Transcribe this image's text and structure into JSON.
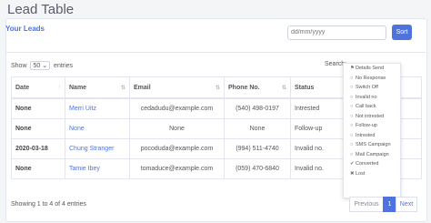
{
  "page_title": "Lead Table",
  "card_header": "Your Leads",
  "date_input": {
    "placeholder": "dd/mm/yyyy"
  },
  "sort_label": "Sort",
  "show": {
    "prefix": "Show",
    "value": "50",
    "suffix": "entries"
  },
  "search_label": "Search:",
  "columns": [
    "Date",
    "Name",
    "Email",
    "Phone No.",
    "Status"
  ],
  "rows": [
    {
      "date": "None",
      "name": "Merri Uitz",
      "email": "cedadudu@example.com",
      "phone": "(540) 498-0197",
      "status": "Intrested"
    },
    {
      "date": "None",
      "name": "None",
      "email": "None",
      "phone": "None",
      "status": "Follow-up"
    },
    {
      "date": "2020-03-18",
      "name": "Chung Stranger",
      "email": "pocoduda@example.com",
      "phone": "(994) 511-4740",
      "status": "Invalid no."
    },
    {
      "date": "None",
      "name": "Tamie Ibey",
      "email": "tomaduce@example.com",
      "phone": "(059) 470-6840",
      "status": "Invalid no."
    }
  ],
  "status_menu": [
    {
      "icon": "flag-icon",
      "glyph": "⚑",
      "label": "Details Send"
    },
    {
      "icon": "circle-icon",
      "glyph": "○",
      "label": "No Response"
    },
    {
      "icon": "circle-icon",
      "glyph": "○",
      "label": "Switch Off"
    },
    {
      "icon": "circle-icon",
      "glyph": "○",
      "label": "Invalid no"
    },
    {
      "icon": "circle-icon",
      "glyph": "○",
      "label": "Call back"
    },
    {
      "icon": "circle-icon",
      "glyph": "○",
      "label": "Not intrested"
    },
    {
      "icon": "circle-icon",
      "glyph": "○",
      "label": "Follow-up"
    },
    {
      "icon": "circle-icon",
      "glyph": "○",
      "label": "Intrested"
    },
    {
      "icon": "circle-icon",
      "glyph": "○",
      "label": "SMS Campaign"
    },
    {
      "icon": "circle-icon",
      "glyph": "○",
      "label": "Mail Campaign"
    },
    {
      "icon": "check-icon",
      "glyph": "✔",
      "label": "Converted"
    },
    {
      "icon": "cross-icon",
      "glyph": "✖",
      "label": "Lost"
    }
  ],
  "footer_text": "Showing 1 to 4 of 4 entries",
  "pagination": {
    "previous": "Previous",
    "page": "1",
    "next": "Next"
  },
  "colors": {
    "primary": "#4e73df",
    "border": "#e3e6f0"
  }
}
